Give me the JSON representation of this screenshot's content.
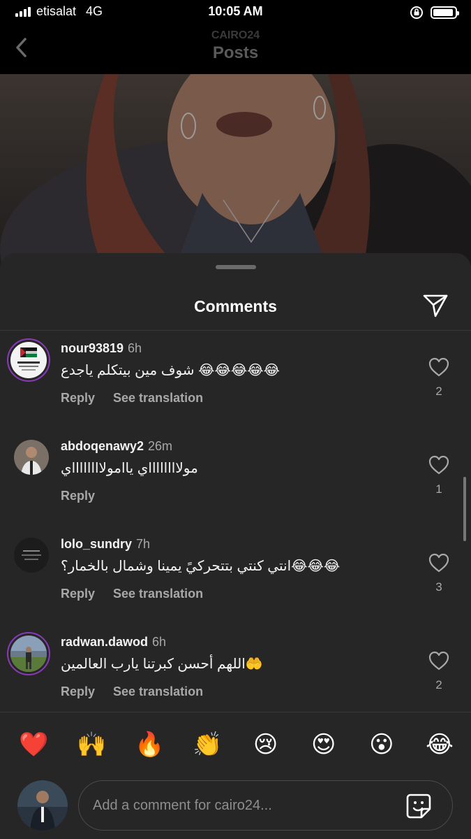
{
  "status_bar": {
    "carrier": "etisalat",
    "network": "4G",
    "time": "10:05 AM"
  },
  "header": {
    "subtitle": "CAIRO24",
    "title": "Posts"
  },
  "sheet": {
    "title": "Comments"
  },
  "comments": [
    {
      "username": "nour93819",
      "time": "6h",
      "text": "شوف مين بيتكلم ياجدع 😂😂😂😂😂",
      "reply_label": "Reply",
      "translation_label": "See translation",
      "likes": "2"
    },
    {
      "username": "abdoqenawy2",
      "time": "26m",
      "text": "مولااااااااي ياامولااااااااي",
      "reply_label": "Reply",
      "translation_label": "",
      "likes": "1"
    },
    {
      "username": "lolo_sundry",
      "time": "7h",
      "text": "انتي كنتي بتتحركيً يمينا وشمال بالخمار؟😂😂😂",
      "reply_label": "Reply",
      "translation_label": "See translation",
      "likes": "3"
    },
    {
      "username": "radwan.dawod",
      "time": "6h",
      "text": "اللهم أحسن كبرتنا يارب العالمين🤲",
      "reply_label": "Reply",
      "translation_label": "See translation",
      "likes": "2"
    }
  ],
  "emoji_bar": [
    "❤️",
    "🙌",
    "🔥",
    "👏",
    "😢",
    "😍",
    "😮",
    "😂"
  ],
  "input": {
    "placeholder": "Add a comment for cairo24..."
  },
  "icons": {
    "back": "chevron-left-icon",
    "share": "paper-plane-icon",
    "like": "heart-outline-icon",
    "sticker": "sticker-icon"
  },
  "colors": {
    "sheet_background": "#262626",
    "secondary_text": "#a8a8a8",
    "story_ring": "#8a3ab9"
  }
}
